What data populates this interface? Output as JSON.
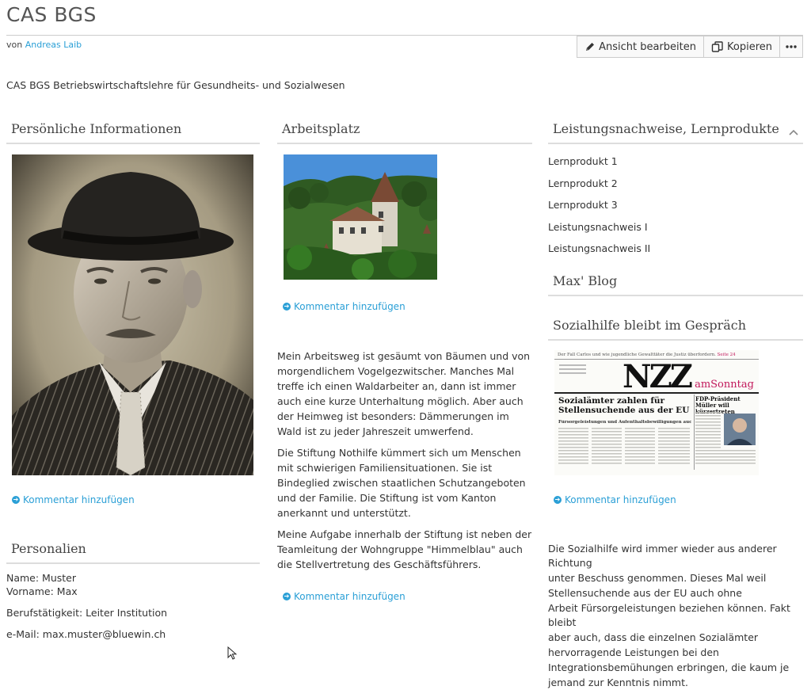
{
  "header": {
    "title": "CAS BGS",
    "by_prefix": "von",
    "author": "Andreas Laib",
    "description": "CAS BGS Betriebswirtschaftslehre für Gesundheits- und Sozialwesen"
  },
  "toolbar": {
    "edit_label": "Ansicht bearbeiten",
    "copy_label": "Kopieren",
    "more_icon": "more-icon"
  },
  "col1": {
    "personal_title": "Persönliche Informationen",
    "comment_link": "Kommentar hinzufügen",
    "personalien_title": "Personalien",
    "name": "Name: Muster",
    "vorname": "Vorname: Max",
    "beruf": "Berufstätigkeit: Leiter Institution",
    "email": "e-Mail: max.muster@bluewin.ch"
  },
  "col2": {
    "arbeitsplatz_title": "Arbeitsplatz",
    "comment_link_1": "Kommentar hinzufügen",
    "paragraphs": [
      "Mein Arbeitsweg ist gesäumt von Bäumen und von morgendlichem Vogelgezwitscher. Manches Mal treffe ich einen Waldarbeiter an, dann ist immer auch eine kurze Unterhaltung möglich. Aber auch der Heimweg ist besonders: Dämmerungen im Wald ist zu jeder Jahreszeit umwerfend.",
      "Die Stiftung Nothilfe kümmert sich um Menschen mit schwierigen Familiensituationen. Sie ist Bindeglied zwischen staatlichen Schutzangeboten und der Familie. Die Stiftung ist vom Kanton anerkannt und unterstützt.",
      "Meine Aufgabe innerhalb der Stiftung ist neben der Teamleitung der Wohngruppe \"Himmelblau\" auch die Stellvertretung des Geschäftsführers."
    ],
    "comment_link_2": "Kommentar hinzufügen"
  },
  "col3": {
    "leistung_title": "Leistungsnachweise, Lernprodukte",
    "items": [
      "Lernprodukt 1",
      "Lernprodukt 2",
      "Lernprodukt 3",
      "Leistungsnachweis I",
      "Leistungsnachweis II"
    ],
    "blog_title": "Max' Blog",
    "sozial_title": "Sozialhilfe bleibt im Gespräch",
    "comment_link": "Kommentar hinzufügen",
    "text_lines": [
      "Die Sozialhilfe wird immer wieder aus anderer Richtung",
      "unter Beschuss genommen. Dieses Mal weil",
      "Stellensuchende aus der EU auch ohne",
      "Arbeit Fürsorgeleistungen beziehen können. Fakt bleibt",
      "aber auch, dass die einzelnen Sozialämter",
      "hervorragende Leistungen bei den",
      "Integrationsbemühungen erbringen, die kaum je",
      "jemand zur Kenntnis nimmt."
    ]
  },
  "newspaper": {
    "top_line": "Der Fall Carlos und wie jugendliche Gewalttäter die Justiz überfordern.",
    "top_line_page": "Seite 24",
    "masthead": "NZZ",
    "masthead_suffix": "amSonntag",
    "headline": "Sozialämter zahlen für Stellensuchende aus der EU",
    "subheadline": "Fürsorgeleistungen und Aufenthaltsbewilligungen auch ohne Arbeit",
    "side_headline": "FDP-Präsident Müller will kürzertreten"
  },
  "colors": {
    "link": "#2a9fd6",
    "nzz_accent": "#c2185b"
  }
}
